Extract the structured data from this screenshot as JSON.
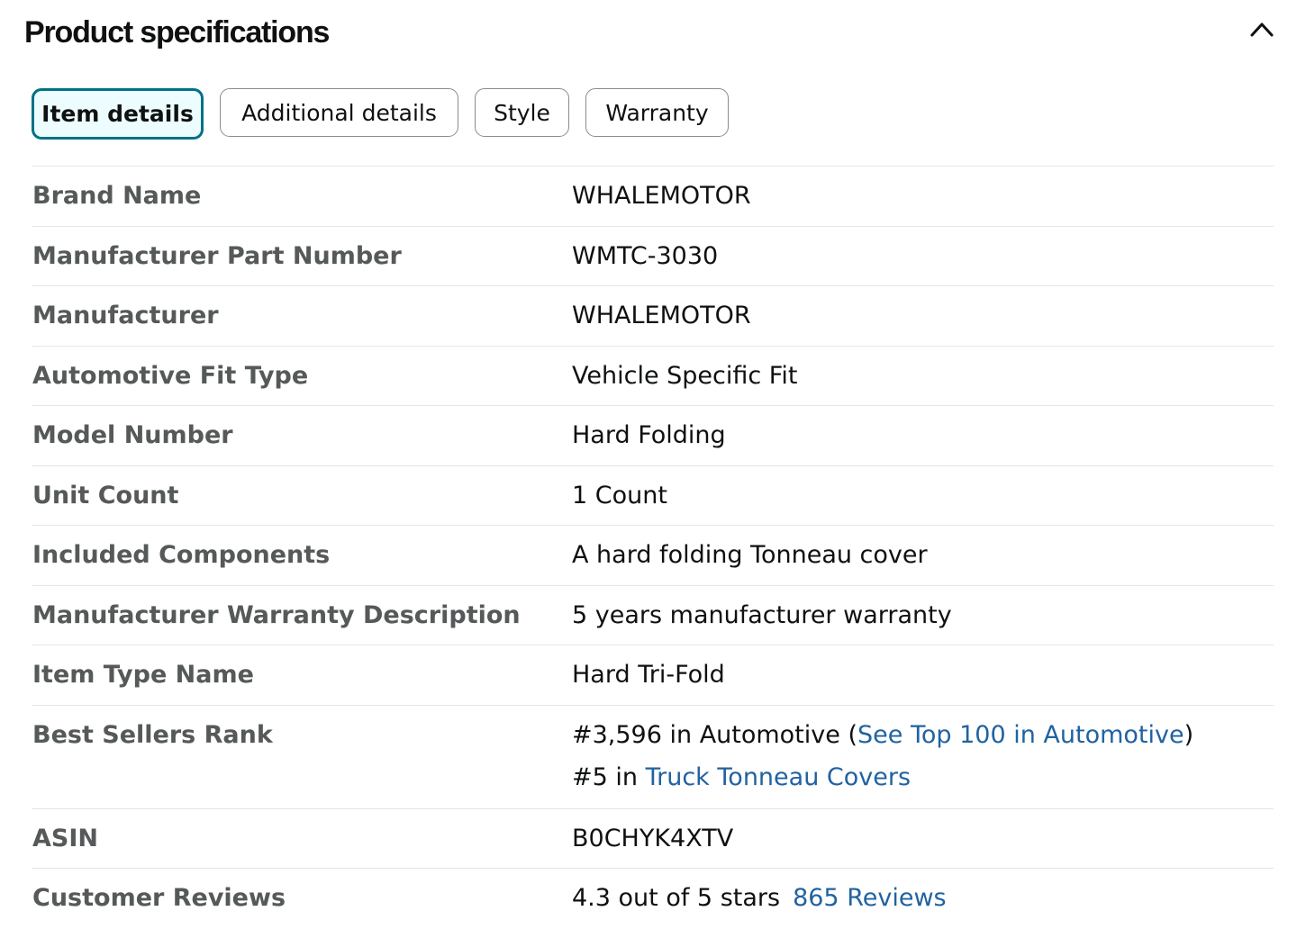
{
  "section": {
    "title": "Product specifications"
  },
  "tabs": [
    {
      "label": "Item details",
      "active": true
    },
    {
      "label": "Additional details",
      "active": false
    },
    {
      "label": "Style",
      "active": false
    },
    {
      "label": "Warranty",
      "active": false
    }
  ],
  "specs": [
    {
      "label": "Brand Name",
      "value": "WHALEMOTOR"
    },
    {
      "label": "Manufacturer Part Number",
      "value": "WMTC-3030"
    },
    {
      "label": "Manufacturer",
      "value": "WHALEMOTOR"
    },
    {
      "label": "Automotive Fit Type",
      "value": "Vehicle Specific Fit"
    },
    {
      "label": "Model Number",
      "value": "Hard Folding"
    },
    {
      "label": "Unit Count",
      "value": "1 Count"
    },
    {
      "label": "Included Components",
      "value": "A hard folding Tonneau cover"
    },
    {
      "label": "Manufacturer Warranty Description",
      "value": "5 years manufacturer warranty"
    },
    {
      "label": "Item Type Name",
      "value": "Hard Tri-Fold"
    },
    {
      "label": "Best Sellers Rank"
    },
    {
      "label": "ASIN",
      "value": "B0CHYK4XTV"
    },
    {
      "label": "Customer Reviews"
    }
  ],
  "best_sellers_rank": {
    "line1_prefix": "#3,596 in Automotive (",
    "line1_link": "See Top 100 in Automotive",
    "line1_suffix": ")",
    "line2_prefix": "#5 in ",
    "line2_link": "Truck Tonneau Covers"
  },
  "customer_reviews": {
    "rating_text": "4.3 out of 5 stars",
    "review_count": "865",
    "reviews_label": "Reviews"
  },
  "colors": {
    "link": "#2162a1",
    "active_tab_border": "#007185",
    "active_tab_bg": "#edfdff",
    "label": "#565959",
    "divider": "#e3e6e6"
  },
  "icons": {
    "collapse": "chevron-up-icon"
  }
}
